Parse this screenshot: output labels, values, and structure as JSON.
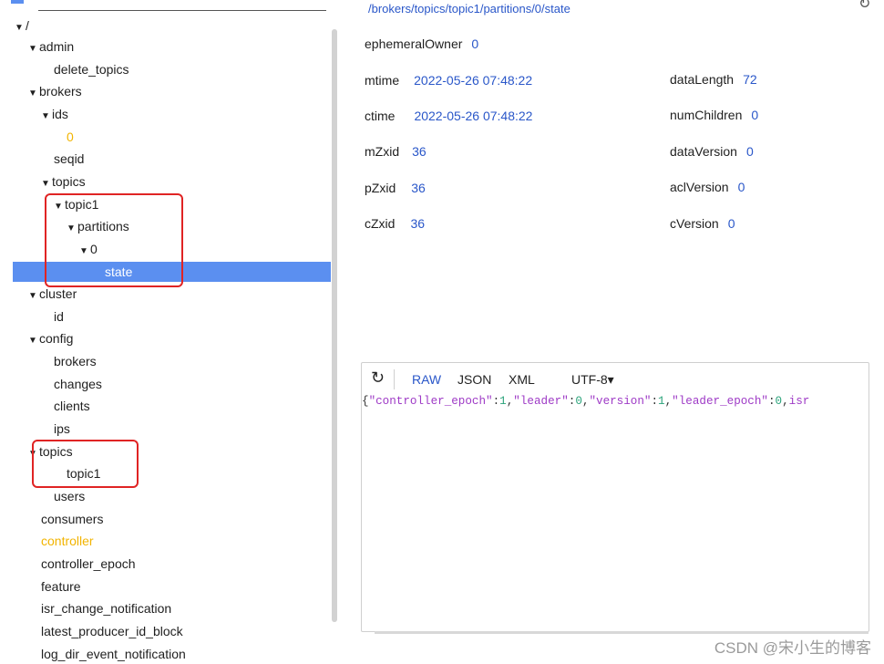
{
  "tree": {
    "root": "/",
    "nodes": [
      {
        "label": "admin",
        "arrow": "▼"
      },
      {
        "label": "delete_topics",
        "arrow": ""
      },
      {
        "label": "brokers",
        "arrow": "▼"
      },
      {
        "label": "ids",
        "arrow": "▼"
      },
      {
        "label": "0",
        "arrow": ""
      },
      {
        "label": "seqid",
        "arrow": ""
      },
      {
        "label": "topics",
        "arrow": "▼"
      },
      {
        "label": "topic1",
        "arrow": "▼"
      },
      {
        "label": "partitions",
        "arrow": "▼"
      },
      {
        "label": "0",
        "arrow": "▼"
      },
      {
        "label": "state",
        "arrow": ""
      },
      {
        "label": "cluster",
        "arrow": "▼"
      },
      {
        "label": "id",
        "arrow": ""
      },
      {
        "label": "config",
        "arrow": "▼"
      },
      {
        "label": "brokers",
        "arrow": ""
      },
      {
        "label": "changes",
        "arrow": ""
      },
      {
        "label": "clients",
        "arrow": ""
      },
      {
        "label": "ips",
        "arrow": ""
      },
      {
        "label": "topics",
        "arrow": "▼"
      },
      {
        "label": "topic1",
        "arrow": ""
      },
      {
        "label": "users",
        "arrow": ""
      },
      {
        "label": "consumers",
        "arrow": ""
      },
      {
        "label": "controller",
        "arrow": ""
      },
      {
        "label": "controller_epoch",
        "arrow": ""
      },
      {
        "label": "feature",
        "arrow": ""
      },
      {
        "label": "isr_change_notification",
        "arrow": ""
      },
      {
        "label": "latest_producer_id_block",
        "arrow": ""
      },
      {
        "label": "log_dir_event_notification",
        "arrow": ""
      }
    ]
  },
  "node": {
    "path": "/brokers/topics/topic1/partitions/0/state",
    "stats": {
      "ephemeralOwner": {
        "key": "ephemeralOwner",
        "value": "0"
      },
      "mtime": {
        "key": "mtime",
        "value": "2022-05-26 07:48:22"
      },
      "ctime": {
        "key": "ctime",
        "value": "2022-05-26 07:48:22"
      },
      "mZxid": {
        "key": "mZxid",
        "value": "36"
      },
      "pZxid": {
        "key": "pZxid",
        "value": "36"
      },
      "cZxid": {
        "key": "cZxid",
        "value": "36"
      },
      "dataLength": {
        "key": "dataLength",
        "value": "72"
      },
      "numChildren": {
        "key": "numChildren",
        "value": "0"
      },
      "dataVersion": {
        "key": "dataVersion",
        "value": "0"
      },
      "aclVersion": {
        "key": "aclVersion",
        "value": "0"
      },
      "cVersion": {
        "key": "cVersion",
        "value": "0"
      }
    }
  },
  "editor": {
    "reload_icon": "↻",
    "formats": [
      "RAW",
      "JSON",
      "XML"
    ],
    "active_format": "RAW",
    "encoding": "UTF-8▾",
    "content": "{\"controller_epoch\":1,\"leader\":0,\"version\":1,\"leader_epoch\":0,\"isr"
  },
  "icons": {
    "top_right": "refresh-icon"
  },
  "watermark": "CSDN @宋小生的博客",
  "colors": {
    "accent": "#2a57c9",
    "selection": "#5b8ff0",
    "highlight_yellow": "#f2b400",
    "red_box": "#e02424"
  }
}
